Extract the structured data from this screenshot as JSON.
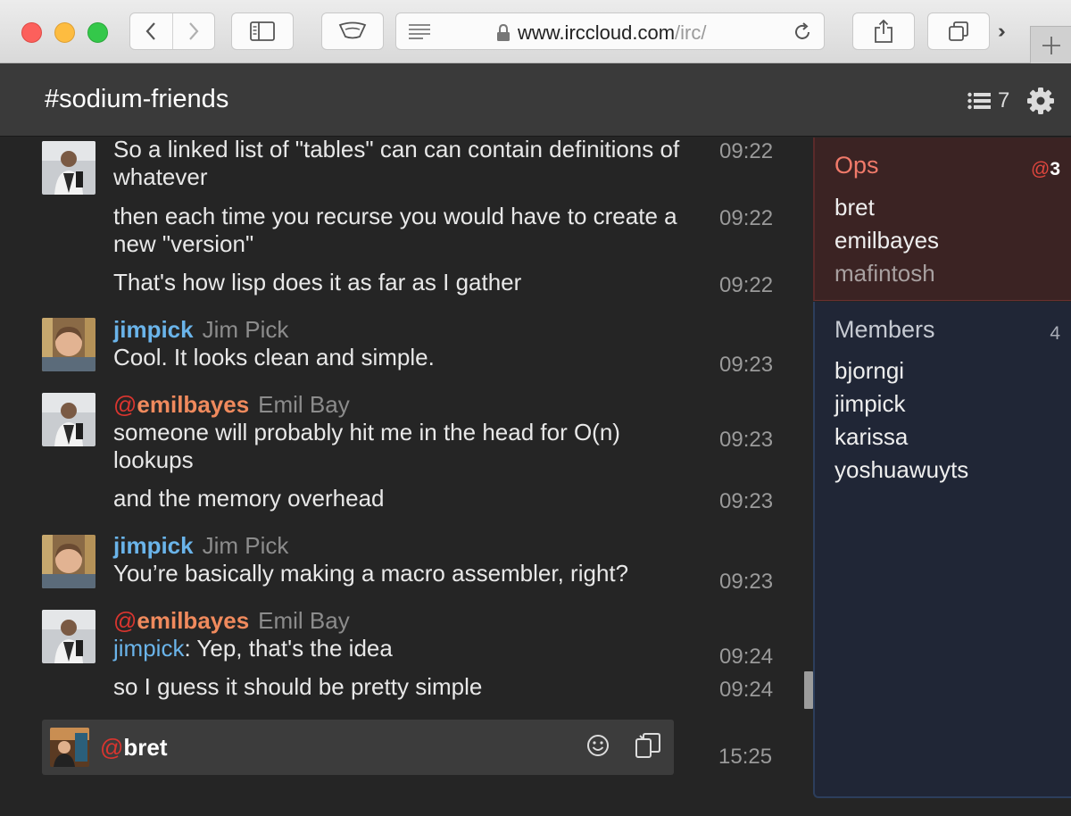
{
  "browser": {
    "url_host": "www.irccloud.com",
    "url_path": "/irc/"
  },
  "channel": {
    "name": "#sodium-friends",
    "member_count": "7"
  },
  "messages": [
    {
      "text": "So a linked list of \"tables\" can can contain definitions of whatever",
      "time": "09:22"
    },
    {
      "text": "then each time you recurse you would have to create a new \"version\"",
      "time": "09:22"
    },
    {
      "text": "That's how lisp does it as far as I gather",
      "time": "09:22"
    },
    {
      "nick": "jimpick",
      "realname": "Jim Pick",
      "text": "Cool. It looks clean and simple.",
      "time": "09:23"
    },
    {
      "nick_prefix": "@",
      "nick": "emilbayes",
      "realname": "Emil Bay",
      "text": "someone will probably hit me in the head for O(n) lookups",
      "time": "09:23"
    },
    {
      "text": "and the memory overhead",
      "time": "09:23"
    },
    {
      "nick": "jimpick",
      "realname": "Jim Pick",
      "text": "You’re basically making a macro assembler, right?",
      "time": "09:23"
    },
    {
      "nick_prefix": "@",
      "nick": "emilbayes",
      "realname": "Emil Bay",
      "mention": "jimpick",
      "text": ": Yep, that's the idea",
      "time": "09:24"
    },
    {
      "text": "so I guess it should be pretty simple",
      "time": "09:24"
    }
  ],
  "input": {
    "prefix": "@",
    "nick": "bret",
    "time": "15:25"
  },
  "sidebar": {
    "ops": {
      "label": "Ops",
      "count_prefix": "@",
      "count": "3",
      "users": [
        "bret",
        "emilbayes",
        "mafintosh"
      ]
    },
    "members": {
      "label": "Members",
      "count": "4",
      "users": [
        "bjorngi",
        "jimpick",
        "karissa",
        "yoshuawuyts"
      ]
    }
  },
  "colors": {
    "voice_nick": "#6ab4ea",
    "op_nick": "#f08a5d",
    "ops_panel_bg": "#3b2323",
    "members_panel_bg": "#202636"
  }
}
